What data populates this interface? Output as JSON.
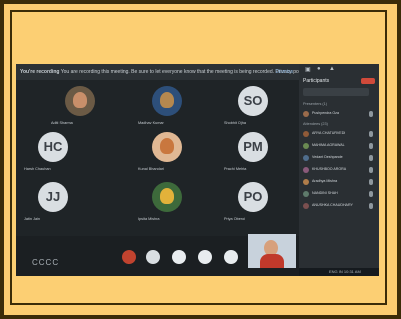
{
  "topbar": {
    "recording_label": "You're recording",
    "recording_text": "You are recording this meeting. Be sure to let everyone know that the meeting is being recorded. Privacy policy",
    "hide_label": "Dismiss"
  },
  "participants": [
    {
      "initials": "",
      "name": "Aditi Sharma",
      "photo": true
    },
    {
      "initials": "",
      "name": "Madhav Kumar",
      "photo": true
    },
    {
      "initials": "SO",
      "name": "Shobhit Ojha",
      "photo": false
    },
    {
      "initials": "HC",
      "name": "Harsh Chauhan",
      "photo": false
    },
    {
      "initials": "",
      "name": "Kunal Bhandari",
      "photo": true
    },
    {
      "initials": "PM",
      "name": "Prachi Mehta",
      "photo": false
    },
    {
      "initials": "JJ",
      "name": "Jatin Jain",
      "photo": false
    },
    {
      "initials": "",
      "name": "Ipsita Mishra",
      "photo": true
    },
    {
      "initials": "PO",
      "name": "Priya Oberoi",
      "photo": false
    }
  ],
  "panel": {
    "title": "Participants",
    "search_placeholder": "Search",
    "section_presenter": "Presenters (1)",
    "presenter_name": "Pushpendra Oza",
    "section_attendees": "Attendees (23)",
    "attendees": [
      "ARYA CHATURVEDI",
      "MAHIMA AGRAWAL",
      "Vedant Deshpande",
      "KHUSHBOO ARORA",
      "Aradhya Mishra",
      "NANDINI SHAH",
      "ANUSHKA CHAUDHARY"
    ]
  },
  "controls": {
    "caption_label": "CCCC"
  },
  "status_text": "ENG IN 10:31 AM"
}
